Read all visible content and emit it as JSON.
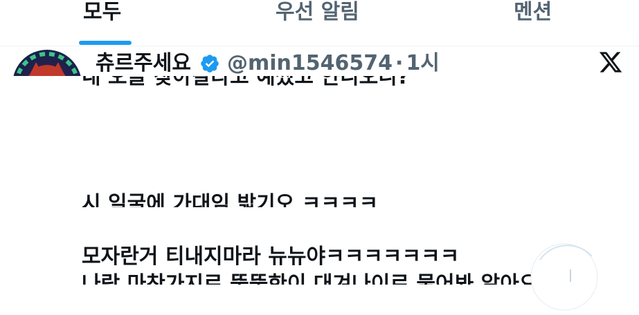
{
  "tabs": [
    {
      "label": "모두",
      "active": true
    },
    {
      "label": "우선 알림",
      "active": false
    },
    {
      "label": "멘션",
      "active": false
    }
  ],
  "tweet": {
    "display_name": "츄르주세요",
    "handle": "@min1546574",
    "separator": "·",
    "time": "1시",
    "verified": true,
    "lines": [
      "내 오늘 찾아갈라고 예쩠고 얀니오니?",
      "시 일굴에 가대임 밟기오 ㅋㅋㅋㅋ",
      "모자란거 티내지마라 뉴뉴야ㅋㅋㅋㅋㅋㅋㅋ",
      "나랑 마찬가지로 뚱뚱한이 대겨나이로 물어봐 알아요"
    ]
  },
  "icons": {
    "verified": "verified-badge-icon",
    "platform": "x-logo-icon",
    "loading": "loading-spinner-icon"
  },
  "colors": {
    "accent": "#1d9bf0",
    "text_primary": "#0f1419",
    "text_secondary": "#536471",
    "background": "#ffffff"
  }
}
